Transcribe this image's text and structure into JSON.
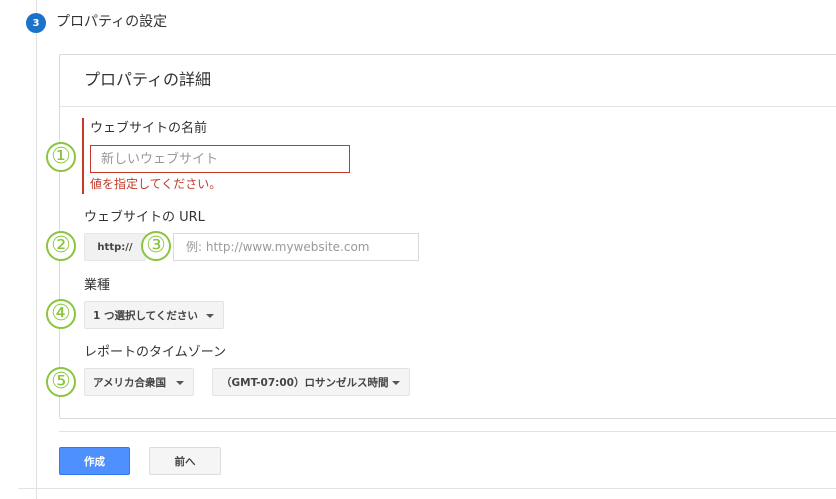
{
  "step": {
    "number": "3",
    "title": "プロパティの設定"
  },
  "card": {
    "title": "プロパティの詳細"
  },
  "website_name": {
    "label": "ウェブサイトの名前",
    "placeholder": "新しいウェブサイト",
    "error": "値を指定してください。"
  },
  "website_url": {
    "label": "ウェブサイトの URL",
    "protocol": "http://",
    "placeholder": "例: http://www.mywebsite.com"
  },
  "industry": {
    "label": "業種",
    "selected": "1 つ選択してください"
  },
  "timezone": {
    "label": "レポートのタイムゾーン",
    "country": "アメリカ合衆国",
    "zone": "（GMT-07:00）ロサンゼルス時間"
  },
  "annotations": [
    "①",
    "②",
    "③",
    "④",
    "⑤"
  ],
  "buttons": {
    "create": "作成",
    "previous": "前へ"
  },
  "colors": {
    "step_blue": "#1a73c8",
    "error_red": "#c53929",
    "annotation_green": "#8bc53f",
    "primary_button": "#4d90fe"
  }
}
